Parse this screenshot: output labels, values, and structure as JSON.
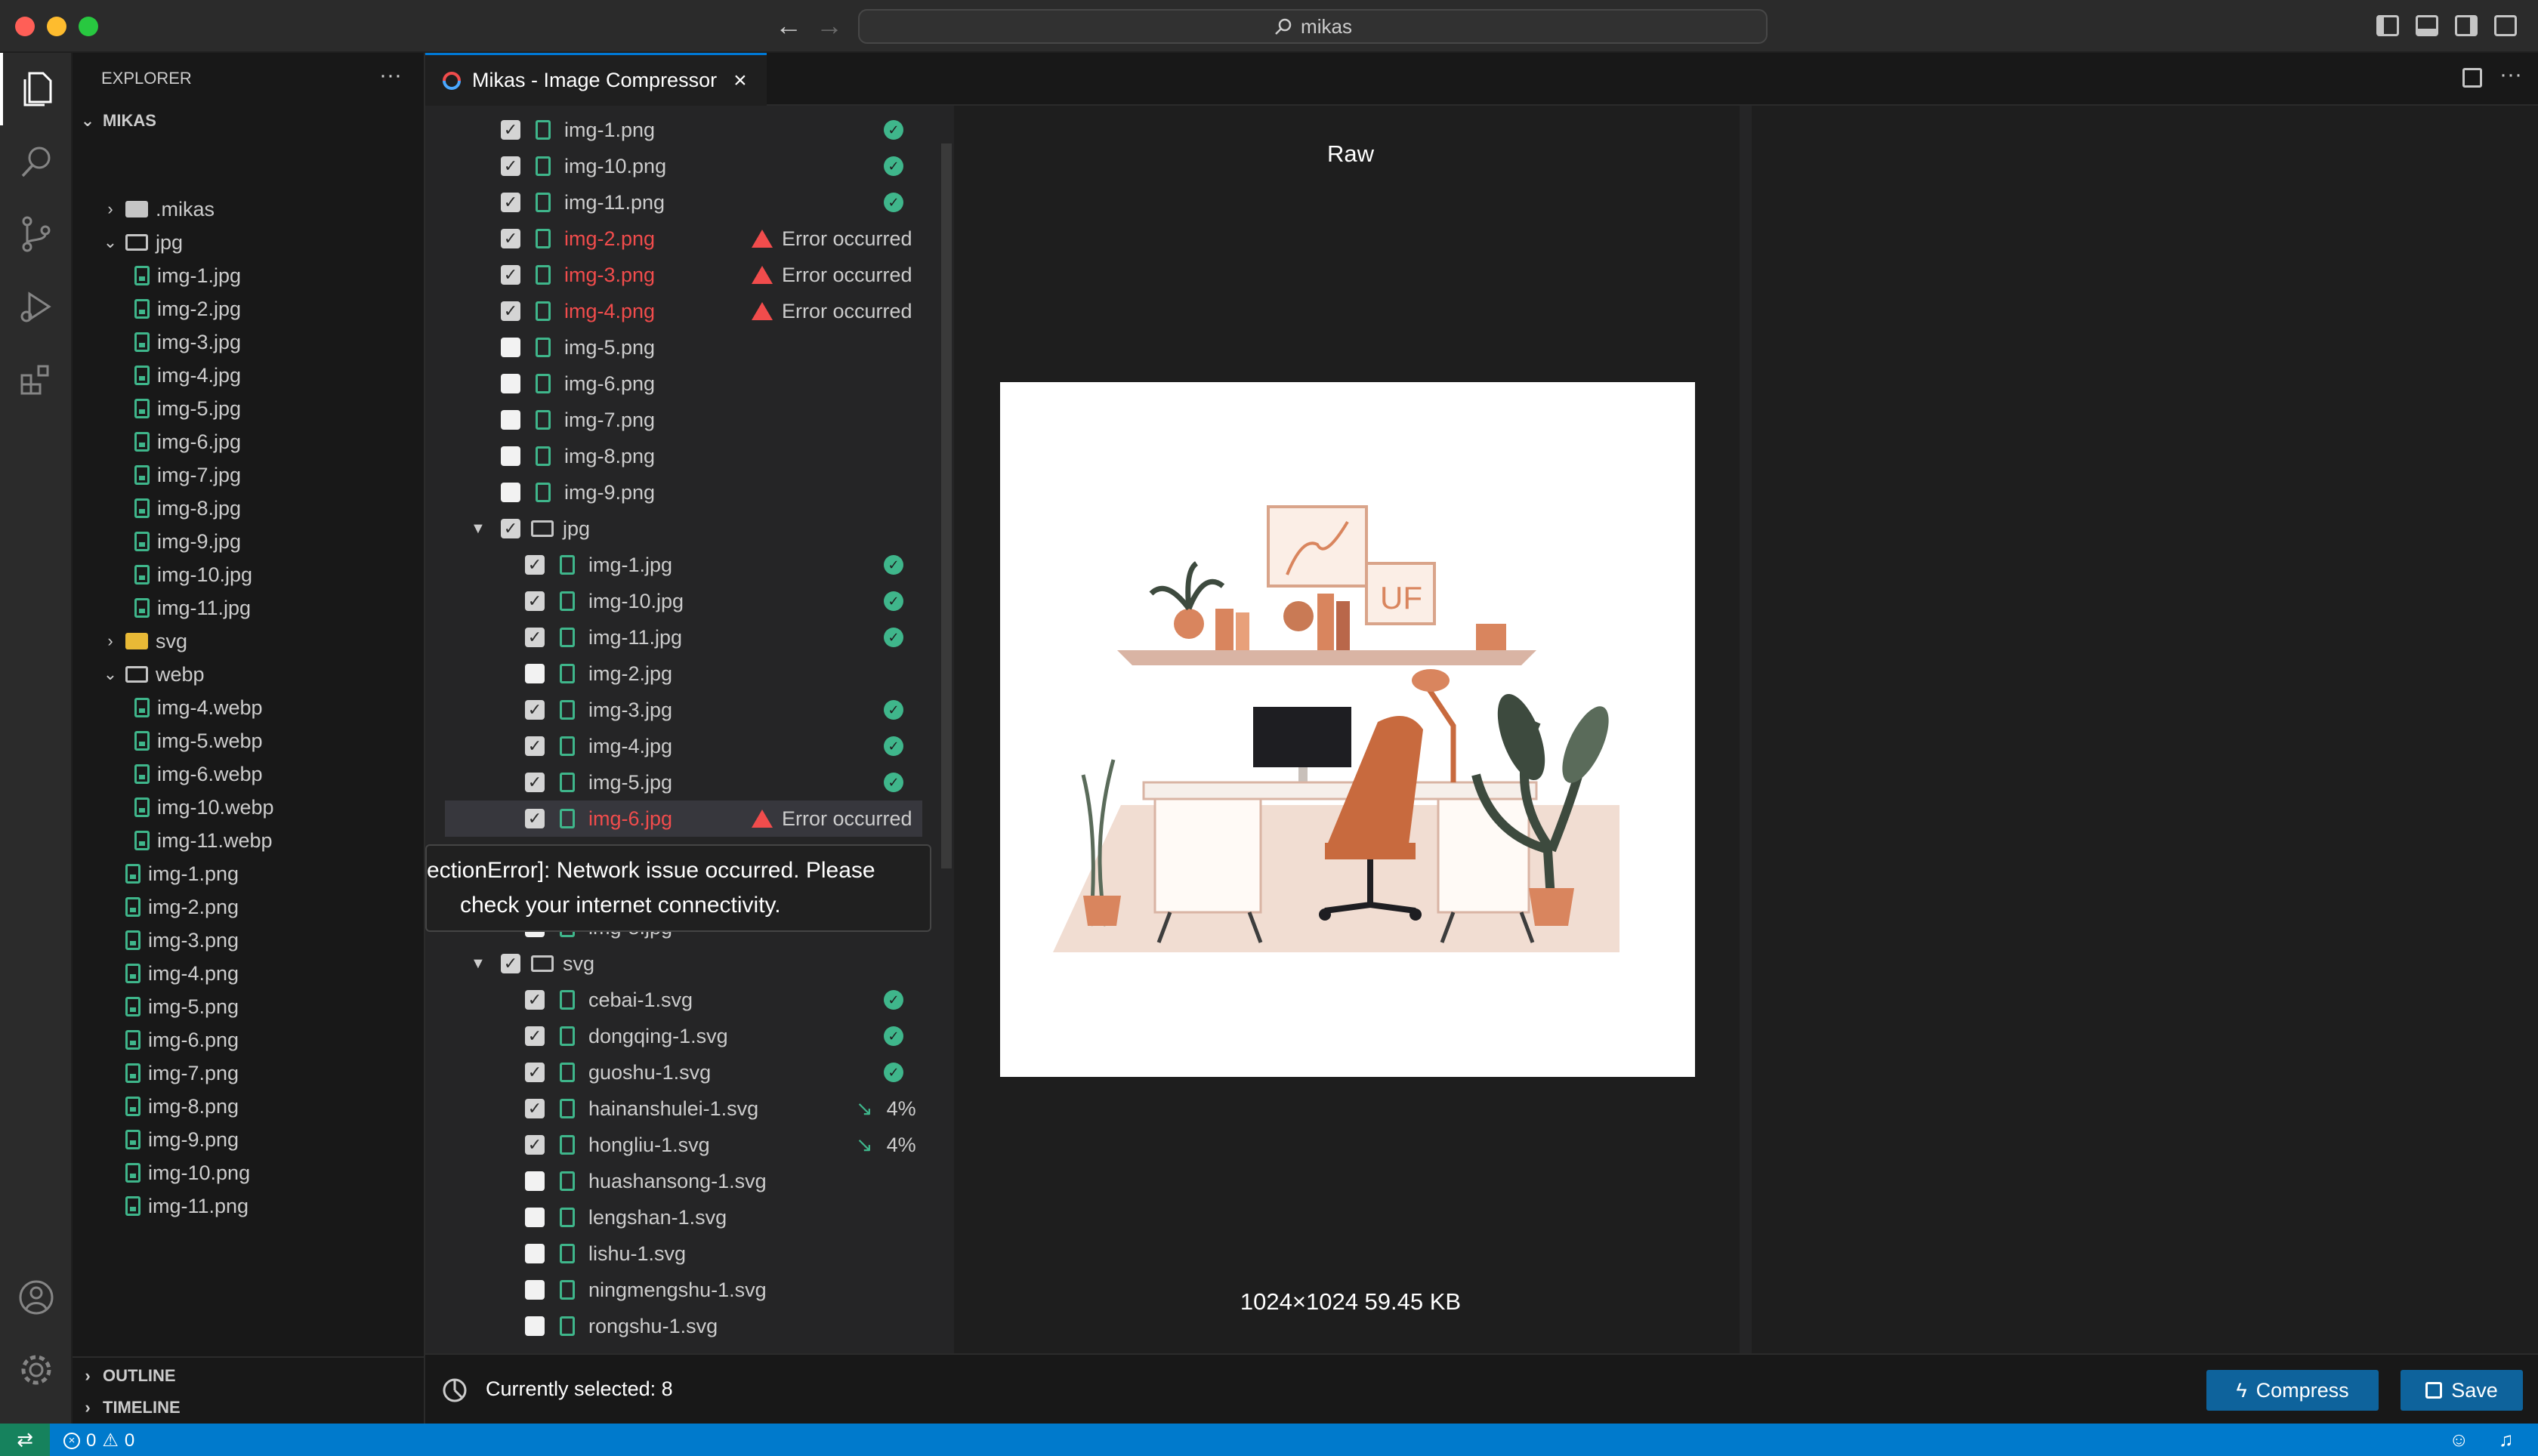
{
  "window": {
    "search_text": "mikas"
  },
  "explorer": {
    "title": "EXPLORER",
    "root": "MIKAS",
    "items": [
      {
        "label": ".mikas",
        "kind": "folder",
        "depth": 1,
        "open": false
      },
      {
        "label": "jpg",
        "kind": "folder",
        "depth": 1,
        "open": true
      },
      {
        "label": "img-1.jpg",
        "kind": "file",
        "depth": 2
      },
      {
        "label": "img-2.jpg",
        "kind": "file",
        "depth": 2
      },
      {
        "label": "img-3.jpg",
        "kind": "file",
        "depth": 2
      },
      {
        "label": "img-4.jpg",
        "kind": "file",
        "depth": 2
      },
      {
        "label": "img-5.jpg",
        "kind": "file",
        "depth": 2
      },
      {
        "label": "img-6.jpg",
        "kind": "file",
        "depth": 2
      },
      {
        "label": "img-7.jpg",
        "kind": "file",
        "depth": 2
      },
      {
        "label": "img-8.jpg",
        "kind": "file",
        "depth": 2
      },
      {
        "label": "img-9.jpg",
        "kind": "file",
        "depth": 2
      },
      {
        "label": "img-10.jpg",
        "kind": "file",
        "depth": 2
      },
      {
        "label": "img-11.jpg",
        "kind": "file",
        "depth": 2
      },
      {
        "label": "svg",
        "kind": "folder-svg",
        "depth": 1,
        "open": false
      },
      {
        "label": "webp",
        "kind": "folder",
        "depth": 1,
        "open": true
      },
      {
        "label": "img-4.webp",
        "kind": "file",
        "depth": 2
      },
      {
        "label": "img-5.webp",
        "kind": "file",
        "depth": 2
      },
      {
        "label": "img-6.webp",
        "kind": "file",
        "depth": 2
      },
      {
        "label": "img-10.webp",
        "kind": "file",
        "depth": 2
      },
      {
        "label": "img-11.webp",
        "kind": "file",
        "depth": 2
      },
      {
        "label": "img-1.png",
        "kind": "file",
        "depth": 1
      },
      {
        "label": "img-2.png",
        "kind": "file",
        "depth": 1
      },
      {
        "label": "img-3.png",
        "kind": "file",
        "depth": 1
      },
      {
        "label": "img-4.png",
        "kind": "file",
        "depth": 1
      },
      {
        "label": "img-5.png",
        "kind": "file",
        "depth": 1
      },
      {
        "label": "img-6.png",
        "kind": "file",
        "depth": 1
      },
      {
        "label": "img-7.png",
        "kind": "file",
        "depth": 1
      },
      {
        "label": "img-8.png",
        "kind": "file",
        "depth": 1
      },
      {
        "label": "img-9.png",
        "kind": "file",
        "depth": 1
      },
      {
        "label": "img-10.png",
        "kind": "file",
        "depth": 1
      },
      {
        "label": "img-11.png",
        "kind": "file",
        "depth": 1
      }
    ],
    "outline_label": "OUTLINE",
    "timeline_label": "TIMELINE"
  },
  "editor": {
    "tab_label": "Mikas - Image Compressor",
    "list": [
      {
        "type": "file",
        "name": "img-1.png",
        "depth": 1,
        "checked": true,
        "status": "ok"
      },
      {
        "type": "file",
        "name": "img-10.png",
        "depth": 1,
        "checked": true,
        "status": "ok"
      },
      {
        "type": "file",
        "name": "img-11.png",
        "depth": 1,
        "checked": true,
        "status": "ok"
      },
      {
        "type": "file",
        "name": "img-2.png",
        "depth": 1,
        "checked": true,
        "status": "error"
      },
      {
        "type": "file",
        "name": "img-3.png",
        "depth": 1,
        "checked": true,
        "status": "error"
      },
      {
        "type": "file",
        "name": "img-4.png",
        "depth": 1,
        "checked": true,
        "status": "error"
      },
      {
        "type": "file",
        "name": "img-5.png",
        "depth": 1,
        "checked": false,
        "status": "none"
      },
      {
        "type": "file",
        "name": "img-6.png",
        "depth": 1,
        "checked": false,
        "status": "none"
      },
      {
        "type": "file",
        "name": "img-7.png",
        "depth": 1,
        "checked": false,
        "status": "none"
      },
      {
        "type": "file",
        "name": "img-8.png",
        "depth": 1,
        "checked": false,
        "status": "none"
      },
      {
        "type": "file",
        "name": "img-9.png",
        "depth": 1,
        "checked": false,
        "status": "none"
      },
      {
        "type": "folder",
        "name": "jpg",
        "depth": 0,
        "checked": true,
        "status": "none"
      },
      {
        "type": "file",
        "name": "img-1.jpg",
        "depth": 2,
        "checked": true,
        "status": "ok"
      },
      {
        "type": "file",
        "name": "img-10.jpg",
        "depth": 2,
        "checked": true,
        "status": "ok"
      },
      {
        "type": "file",
        "name": "img-11.jpg",
        "depth": 2,
        "checked": true,
        "status": "ok"
      },
      {
        "type": "file",
        "name": "img-2.jpg",
        "depth": 2,
        "checked": false,
        "status": "none"
      },
      {
        "type": "file",
        "name": "img-3.jpg",
        "depth": 2,
        "checked": true,
        "status": "ok"
      },
      {
        "type": "file",
        "name": "img-4.jpg",
        "depth": 2,
        "checked": true,
        "status": "ok"
      },
      {
        "type": "file",
        "name": "img-5.jpg",
        "depth": 2,
        "checked": true,
        "status": "ok"
      },
      {
        "type": "file",
        "name": "img-6.jpg",
        "depth": 2,
        "checked": true,
        "status": "error",
        "selected": true
      },
      {
        "type": "hidden"
      },
      {
        "type": "hidden"
      },
      {
        "type": "file",
        "name": "img-8.jpg",
        "depth": 2,
        "checked": false,
        "status": "none"
      },
      {
        "type": "folder",
        "name": "svg",
        "depth": 0,
        "checked": true,
        "status": "none"
      },
      {
        "type": "file",
        "name": "cebai-1.svg",
        "depth": 2,
        "checked": true,
        "status": "ok"
      },
      {
        "type": "file",
        "name": "dongqing-1.svg",
        "depth": 2,
        "checked": true,
        "status": "ok"
      },
      {
        "type": "file",
        "name": "guoshu-1.svg",
        "depth": 2,
        "checked": true,
        "status": "ok"
      },
      {
        "type": "file",
        "name": "hainanshulei-1.svg",
        "depth": 2,
        "checked": true,
        "status": "pct",
        "pct": "4%"
      },
      {
        "type": "file",
        "name": "hongliu-1.svg",
        "depth": 2,
        "checked": true,
        "status": "pct",
        "pct": "4%"
      },
      {
        "type": "file",
        "name": "huashansong-1.svg",
        "depth": 2,
        "checked": false,
        "status": "none"
      },
      {
        "type": "file",
        "name": "lengshan-1.svg",
        "depth": 2,
        "checked": false,
        "status": "none"
      },
      {
        "type": "file",
        "name": "lishu-1.svg",
        "depth": 2,
        "checked": false,
        "status": "none"
      },
      {
        "type": "file",
        "name": "ningmengshu-1.svg",
        "depth": 2,
        "checked": false,
        "status": "none"
      },
      {
        "type": "file",
        "name": "rongshu-1.svg",
        "depth": 2,
        "checked": false,
        "status": "none"
      }
    ],
    "error_label": "Error occurred",
    "tooltip_line1": "ectionError]: Network issue occurred. Please",
    "tooltip_line2": "check your internet connectivity.",
    "preview_title": "Raw",
    "image_info": "1024×1024 59.45 KB",
    "selected_count": "Currently selected: 8",
    "compress_label": "Compress",
    "save_label": "Save"
  },
  "statusbar": {
    "errors": "0",
    "warnings": "0"
  },
  "colors": {
    "accent": "#007acc",
    "error": "#f14c4c",
    "ok": "#3fb68b"
  }
}
